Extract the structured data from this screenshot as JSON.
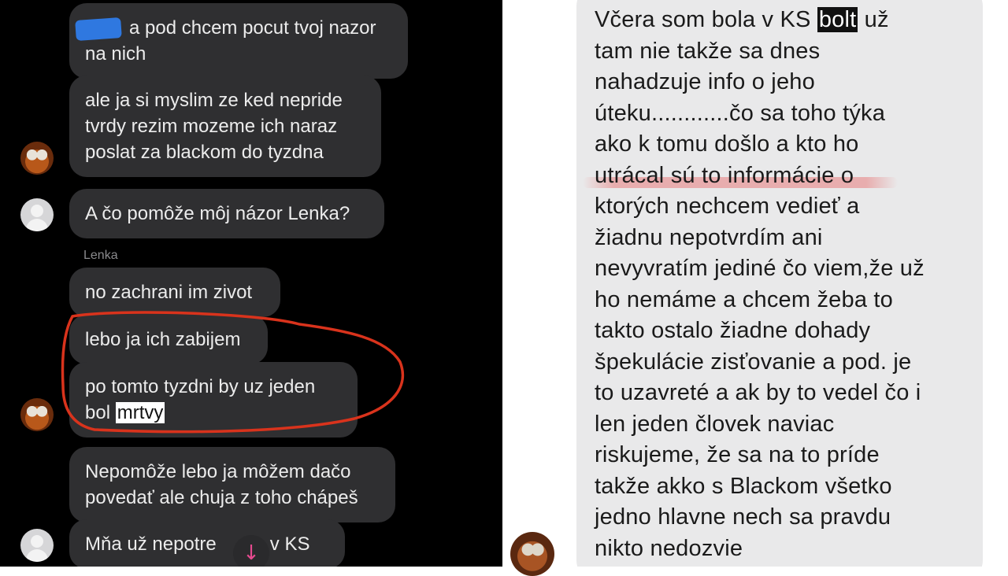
{
  "left_chat": {
    "messages": [
      {
        "text": "a pod chcem pocut tvoj nazor\nna nich"
      },
      {
        "text": "ale ja si myslim ze ked nepride\ntvrdy rezim mozeme ich naraz\nposlat za blackom do tyzdna"
      },
      {
        "text": "A čo pomôže môj názor Lenka?"
      },
      {
        "text": "no zachrani im zivot"
      },
      {
        "text": "lebo ja ich zabijem"
      },
      {
        "text_before": "po tomto tyzdni by uz jeden\nbol ",
        "highlight": "mrtvy"
      },
      {
        "text": "Nepomôže lebo ja môžem dačo\npovedať ale chuja z toho chápeš"
      },
      {
        "text_a": "Mňa už nepotre",
        "text_b": "e v KS"
      }
    ],
    "sender_name": "Lenka",
    "scroll_icon": "arrow-down-icon",
    "annotation_color": "#d9331c",
    "redaction_color": "#2f78e0"
  },
  "right_chat": {
    "line1_before": "Včera som bola v KS ",
    "line1_highlight": "bolt",
    "line1_after": " už",
    "body": "tam nie takže sa dnes\nnahadzuje info o jeho\núteku............čo sa toho týka\nako k tomu došlo a kto ho\nutrácal sú to informácie o\nktorých nechcem vedieť a\nžiadnu nepotvrdím ani\nnevyvratím jediné čo viem,že už\nho nemáme a chcem žeba to\ntakto ostalo žiadne dohady\nšpekulácie zisťovanie a pod. je\nto uzavreté a ak by to vedel čo i\nlen jeden človek naviac\nriskujeme, že sa na to príde\ntakže akko s Blackom všetko\njedno  hlavne nech sa pravdu\nnikto nedozvie",
    "bubble_color": "#e9e9ea"
  }
}
